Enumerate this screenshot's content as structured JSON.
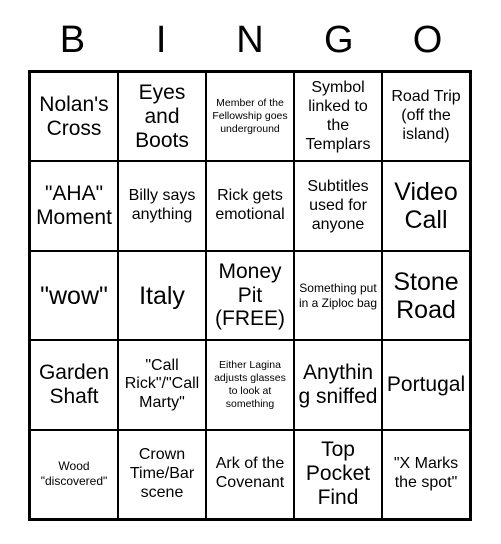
{
  "header": {
    "letters": [
      "B",
      "I",
      "N",
      "G",
      "O"
    ]
  },
  "grid": {
    "rows": [
      [
        {
          "text": "Nolan's Cross",
          "size": "lg"
        },
        {
          "text": "Eyes and Boots",
          "size": "lg"
        },
        {
          "text": "Member of the Fellowship goes underground",
          "size": "xs"
        },
        {
          "text": "Symbol linked to the Templars",
          "size": "md"
        },
        {
          "text": "Road Trip (off the island)",
          "size": "md"
        }
      ],
      [
        {
          "text": "\"AHA\" Moment",
          "size": "lg"
        },
        {
          "text": "Billy says anything",
          "size": "md"
        },
        {
          "text": "Rick gets emotional",
          "size": "md"
        },
        {
          "text": "Subtitles used for anyone",
          "size": "md"
        },
        {
          "text": "Video Call",
          "size": "xl"
        }
      ],
      [
        {
          "text": "\"wow\"",
          "size": "xl"
        },
        {
          "text": "Italy",
          "size": "xl"
        },
        {
          "text": "Money Pit (FREE)",
          "size": "lg"
        },
        {
          "text": "Something put in a Ziploc bag",
          "size": "sm"
        },
        {
          "text": "Stone Road",
          "size": "xl"
        }
      ],
      [
        {
          "text": "Garden Shaft",
          "size": "lg"
        },
        {
          "text": "\"Call Rick\"/\"Call Marty\"",
          "size": "md"
        },
        {
          "text": "Either Lagina adjusts glasses to look at something",
          "size": "xs"
        },
        {
          "text": "Anything sniffed",
          "size": "lg"
        },
        {
          "text": "Portugal",
          "size": "lg"
        }
      ],
      [
        {
          "text": "Wood \"discovered\"",
          "size": "sm"
        },
        {
          "text": "Crown Time/Bar scene",
          "size": "md"
        },
        {
          "text": "Ark of the Covenant",
          "size": "md"
        },
        {
          "text": "Top Pocket Find",
          "size": "lg"
        },
        {
          "text": "\"X Marks the spot\"",
          "size": "md"
        }
      ]
    ]
  },
  "colors": {
    "background": "#ffffff",
    "text": "#000000",
    "grid_line": "#000000"
  }
}
